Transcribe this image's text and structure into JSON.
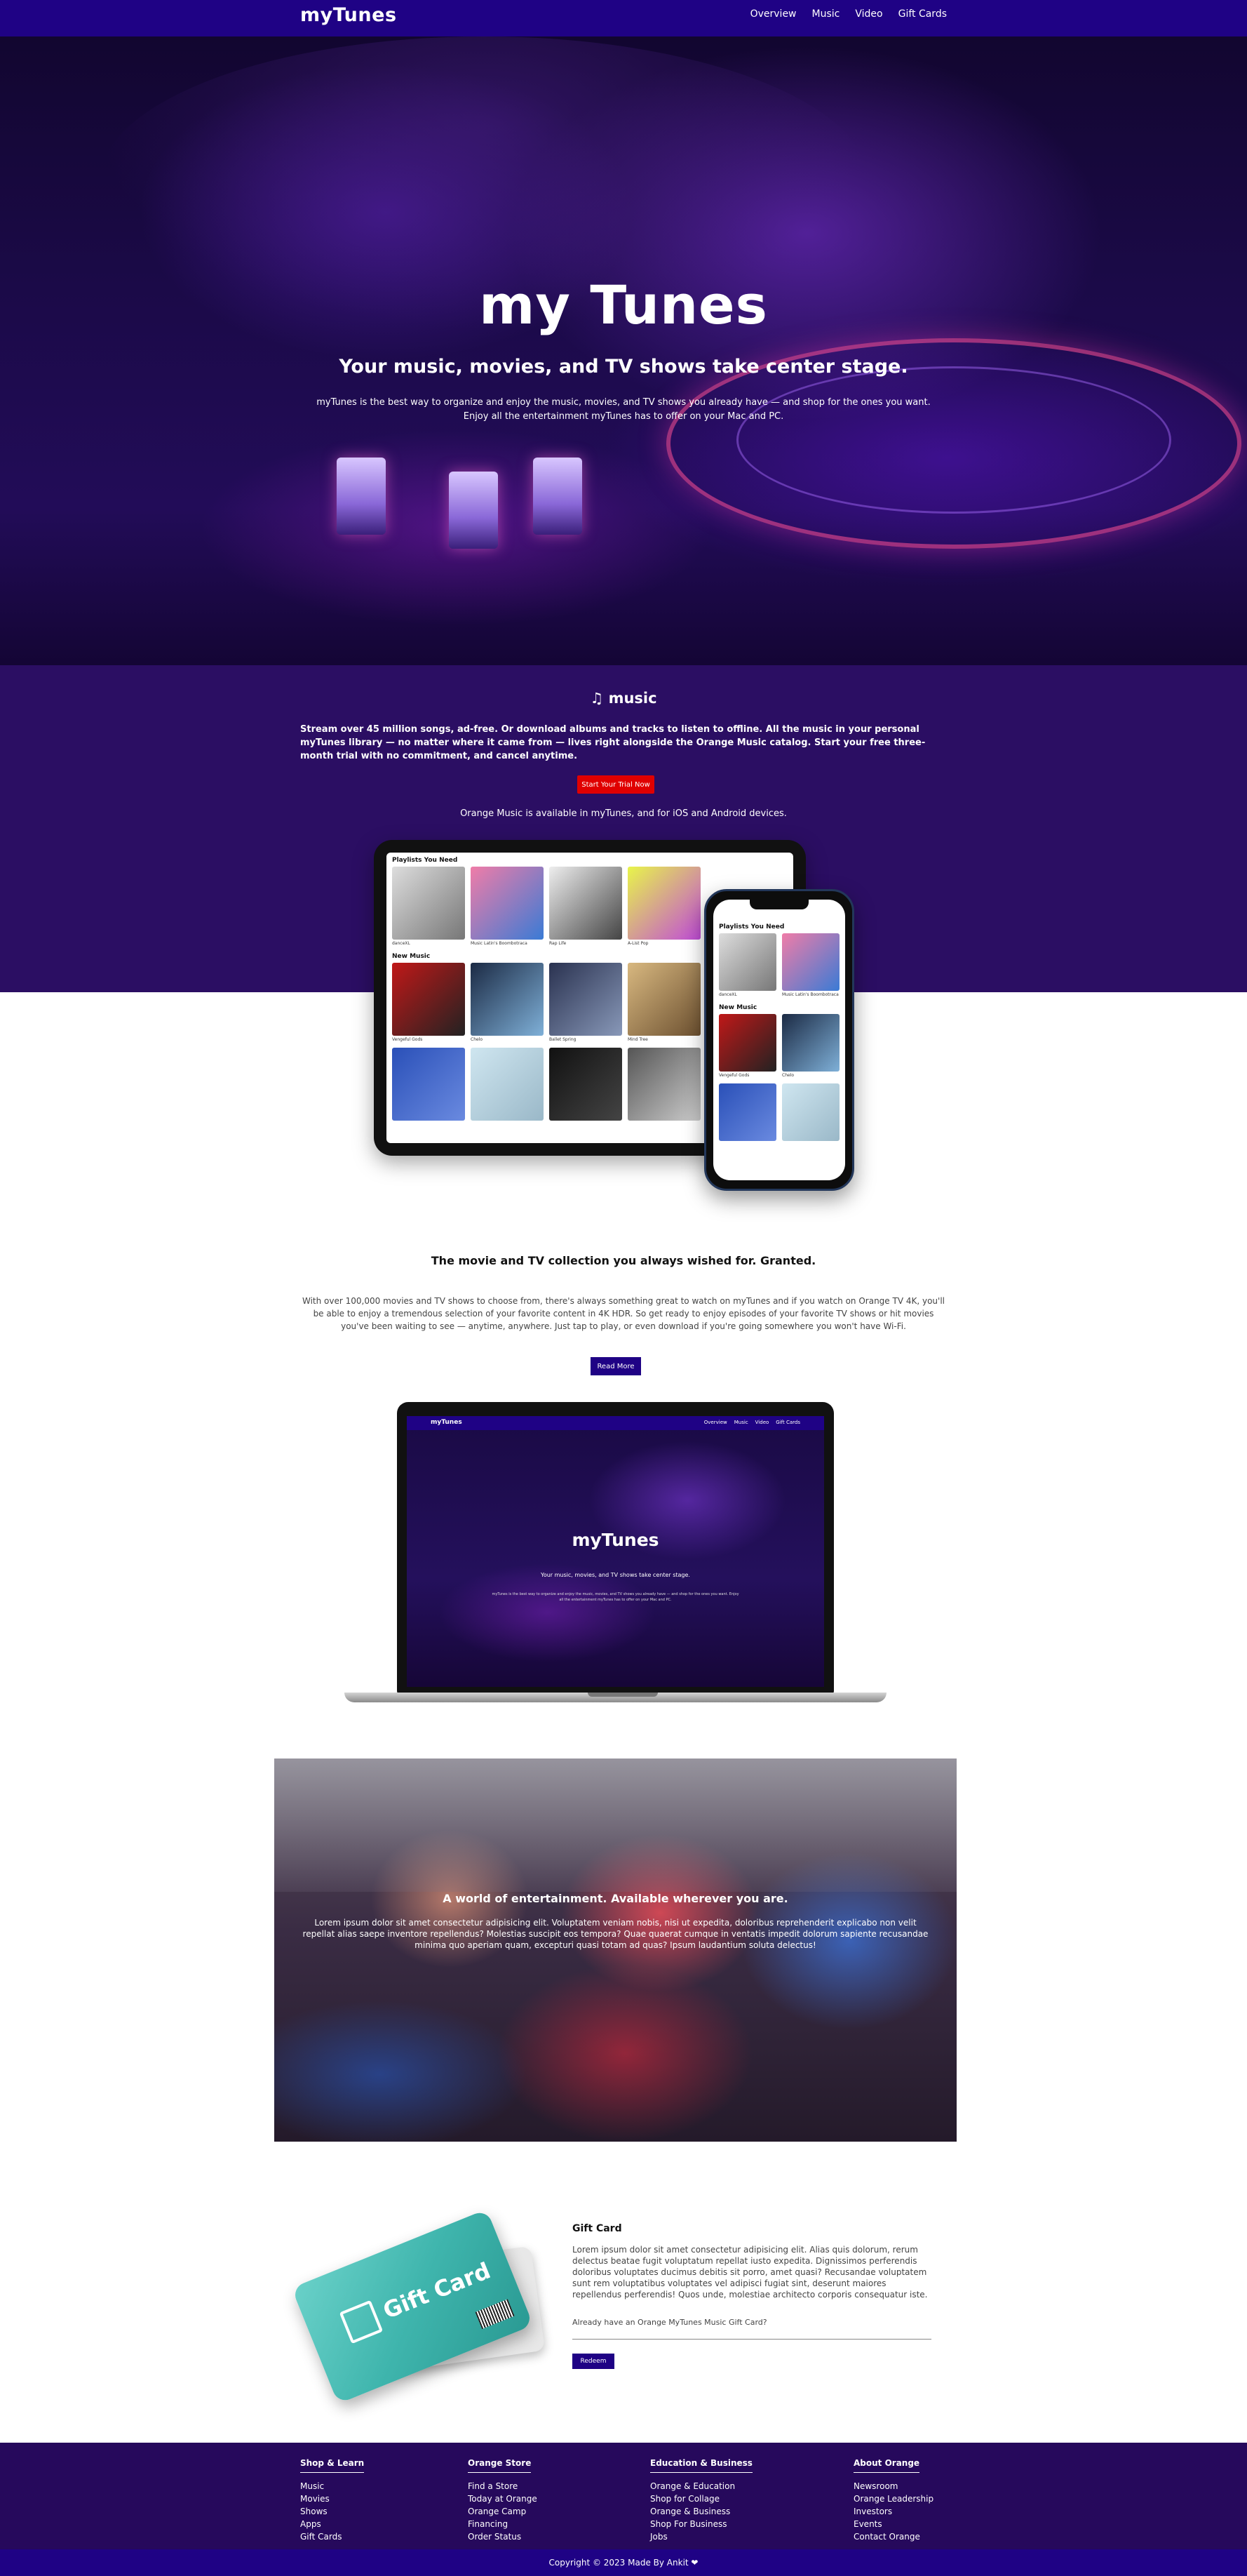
{
  "nav": {
    "brand": "myTunes",
    "links": [
      "Overview",
      "Music",
      "Video",
      "Gift Cards"
    ]
  },
  "hero": {
    "title": "my Tunes",
    "subtitle": "Your music, movies, and TV shows take center stage.",
    "text": "myTunes is the best way to organize and enjoy the music, movies, and TV shows you already have — and shop for the ones you want. Enjoy all the entertainment myTunes has to offer on your Mac and PC."
  },
  "music": {
    "logo_glyph": "♫",
    "logo_text": "music",
    "lead": "Stream over 45 million songs, ad-free. Or download albums and tracks to listen to offline. All the music in your personal myTunes library — no matter where it came from — lives right alongside the Orange Music catalog. Start your free three-month trial with no commitment, and cancel anytime.",
    "trial_button": "Start Your Trial Now",
    "availability": "Orange Music is available in myTunes, and for iOS and Android devices.",
    "tablet": {
      "section1": "Playlists You Need",
      "section2": "New Music",
      "row1": [
        "danceXL",
        "Music Latin's Boombotraca",
        "Rap Life",
        "A-List Pop"
      ],
      "row2": [
        "Vengeful Gods",
        "Chelo",
        "Ballet Spring",
        "Mind Tree"
      ]
    },
    "phone": {
      "section1": "Playlists You Need",
      "section2": "New Music",
      "row1": [
        "danceXL",
        "Music Latin's Boombotraca"
      ],
      "row2": [
        "Vengeful Gods",
        "Chelo"
      ]
    }
  },
  "movie": {
    "title": "The movie and TV collection you always wished for. Granted.",
    "text": "With over 100,000 movies and TV shows to choose from, there's always something great to watch on myTunes and if you watch on Orange TV 4K, you'll be able to enjoy a tremendous selection of your favorite content in 4K HDR. So get ready to enjoy episodes of your favorite TV shows or hit movies you've been waiting to see — anytime, anywhere. Just tap to play, or even download if you're going somewhere you won't have Wi-Fi.",
    "button": "Read More",
    "laptop": {
      "brand": "myTunes",
      "links": [
        "Overview",
        "Music",
        "Video",
        "Gift Cards"
      ],
      "title": "myTunes",
      "subtitle": "Your music, movies, and TV shows take center stage.",
      "text": "myTunes is the best way to organize and enjoy the music, movies, and TV shows you already have — and shop for the ones you want. Enjoy all the entertainment myTunes has to offer on your Mac and PC."
    }
  },
  "entertainment": {
    "title": "A world of entertainment. Available wherever you are.",
    "text": "Lorem ipsum dolor sit amet consectetur adipisicing elit. Voluptatem veniam nobis, nisi ut expedita, doloribus reprehenderit explicabo non velit repellat alias saepe inventore repellendus? Molestias suscipit eos tempora? Quae quaerat cumque in ventatis impedit dolorum sapiente recusandae minima quo aperiam quam, excepturi quasi totam ad quas? Ipsum laudantium soluta delectus!"
  },
  "gift": {
    "card_label": "Gift Card",
    "title": "Gift Card",
    "text": "Lorem ipsum dolor sit amet consectetur adipisicing elit. Alias quis dolorum, rerum delectus beatae fugit voluptatum repellat iusto expedita. Dignissimos perferendis doloribus voluptates ducimus debitis sit porro, amet quasi? Recusandae voluptatem sunt rem voluptatibus voluptates vel adipisci fugiat sint, deserunt maiores repellendus perferendis! Quos unde, molestiae architecto corporis consequatur iste.",
    "question": "Already have an Orange MyTunes Music Gift Card?",
    "button": "Redeem"
  },
  "footer": {
    "columns": [
      {
        "title": "Shop & Learn",
        "items": [
          "Music",
          "Movies",
          "Shows",
          "Apps",
          "Gift Cards"
        ]
      },
      {
        "title": "Orange Store",
        "items": [
          "Find a Store",
          "Today at Orange",
          "Orange Camp",
          "Financing",
          "Order Status"
        ]
      },
      {
        "title": "Education & Business",
        "items": [
          "Orange & Education",
          "Shop for Collage",
          "Orange & Business",
          "Shop For Business",
          "Jobs"
        ]
      },
      {
        "title": "About Orange",
        "items": [
          "Newsroom",
          "Orange Leadership",
          "Investors",
          "Events",
          "Contact Orange"
        ]
      }
    ],
    "copyright": "Copyright © 2023 Made By Ankit ❤"
  },
  "colors": {
    "nav": "#1f0285",
    "music_bg": "#2b0e63",
    "trial_button": "#e00000",
    "gift_card": "#3fb5ad"
  }
}
